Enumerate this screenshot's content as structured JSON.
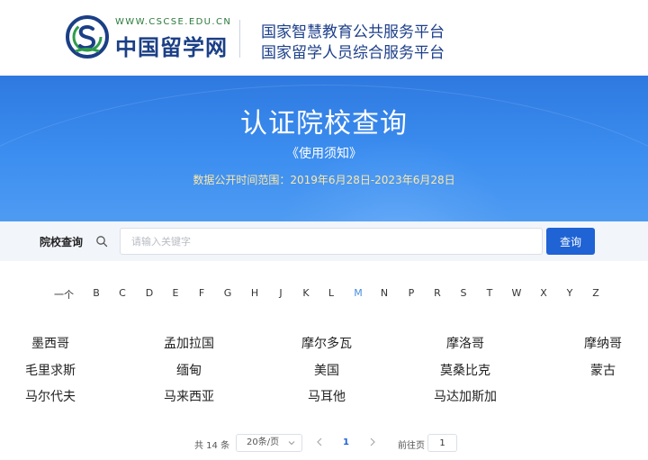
{
  "header": {
    "logo_url": "WWW.CSCSE.EDU.CN",
    "logo_name": "中国留学网",
    "platform_line1": "国家智慧教育公共服务平台",
    "platform_line2": "国家留学人员综合服务平台"
  },
  "banner": {
    "title": "认证院校查询",
    "notice_link": "《使用须知》",
    "date_range": "数据公开时间范围：2019年6月28日-2023年6月28日"
  },
  "search": {
    "label": "院校查询",
    "placeholder": "请输入关键字",
    "value": "",
    "button": "查询",
    "icon": "search-icon"
  },
  "letters": {
    "items": [
      "一个",
      "B",
      "C",
      "D",
      "E",
      "F",
      "G",
      "H",
      "J",
      "K",
      "L",
      "M",
      "N",
      "P",
      "R",
      "S",
      "T",
      "W",
      "X",
      "Y",
      "Z"
    ],
    "active": "M",
    "active_color": "#4a8ee0"
  },
  "countries": [
    "墨西哥",
    "孟加拉国",
    "摩尔多瓦",
    "摩洛哥",
    "摩纳哥",
    "毛里求斯",
    "缅甸",
    "美国",
    "莫桑比克",
    "蒙古",
    "马尔代夫",
    "马来西亚",
    "马耳他",
    "马达加斯加"
  ],
  "pagination": {
    "total": "共 14 条",
    "page_size": "20条/页",
    "current_page": "1",
    "goto_label": "前往页",
    "goto_value": "1"
  },
  "colors": {
    "brand_blue": "#1f63d4",
    "banner_blue": "#3c8ef0",
    "date_text": "#fde7a6"
  }
}
